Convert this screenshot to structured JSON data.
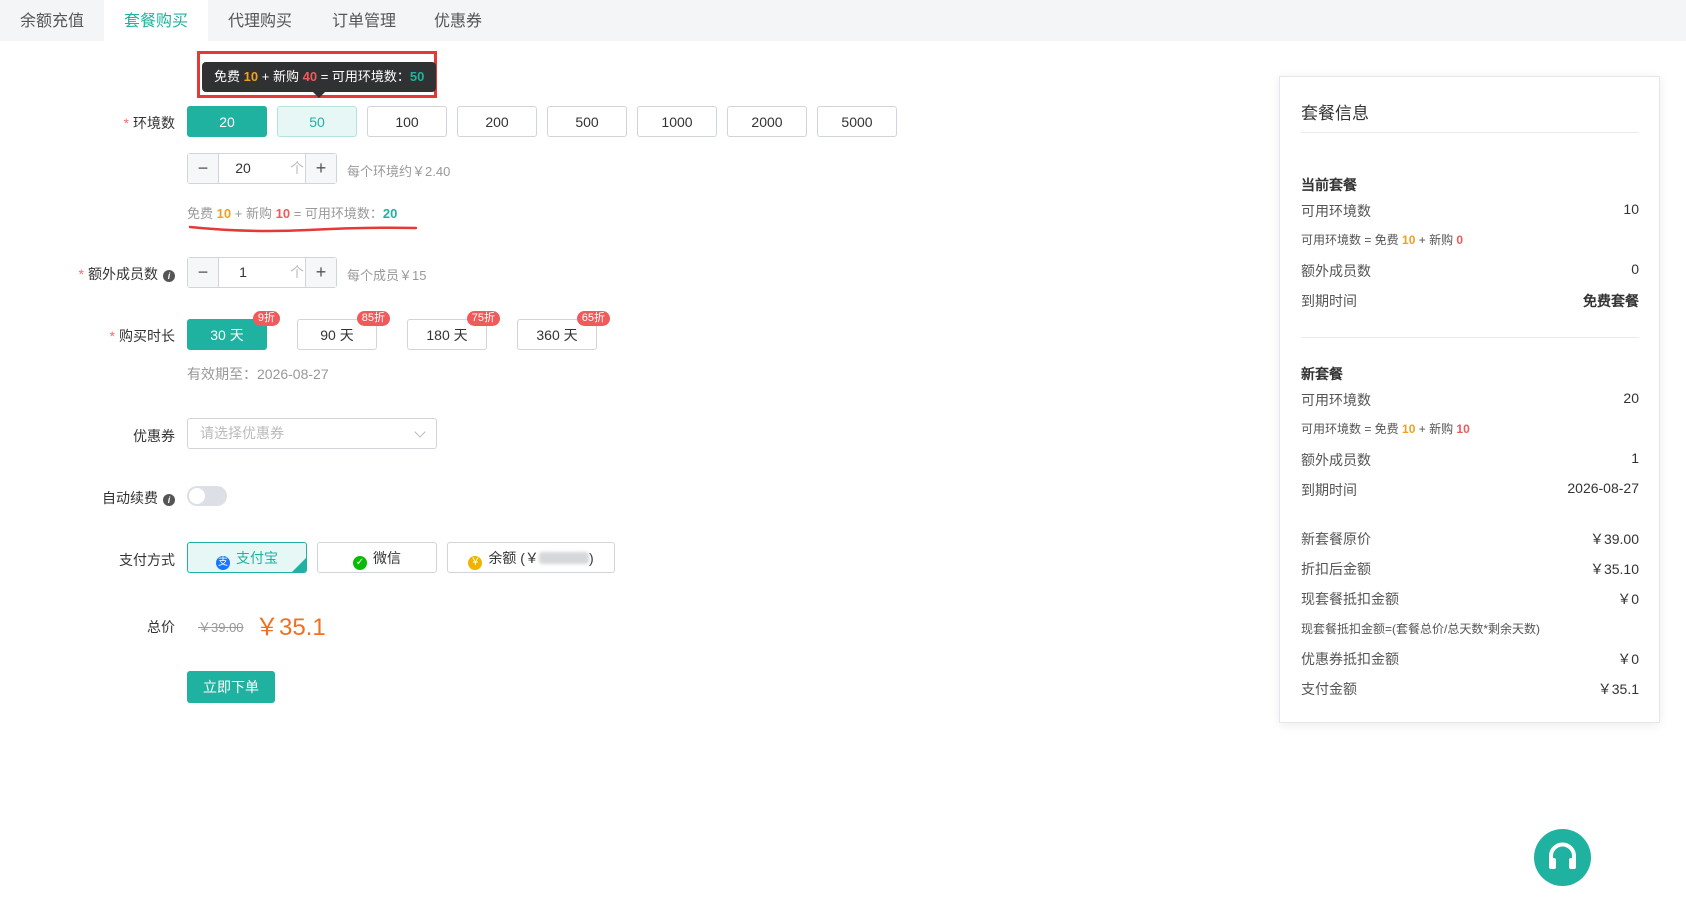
{
  "tabs": [
    "余额充值",
    "套餐购买",
    "代理购买",
    "订单管理",
    "优惠券"
  ],
  "tooltip": {
    "free_label": "免费",
    "free": "10",
    "plus": "+",
    "new_label": "新购",
    "new": "40",
    "eq": "=",
    "avail_label": "可用环境数：",
    "avail": "50"
  },
  "env": {
    "label": "环境数",
    "options": [
      "20",
      "50",
      "100",
      "200",
      "500",
      "1000",
      "2000",
      "5000"
    ],
    "stepper_value": "20",
    "stepper_unit": "个",
    "price_hint": "每个环境约￥2.40",
    "summary": {
      "free_label": "免费",
      "free": "10",
      "plus": "+",
      "new_label": "新购",
      "new": "10",
      "eq": "=",
      "avail_label": "可用环境数：",
      "avail": "20"
    }
  },
  "members": {
    "label": "额外成员数",
    "stepper_value": "1",
    "stepper_unit": "个",
    "price_hint": "每个成员￥15"
  },
  "duration": {
    "label": "购买时长",
    "options": [
      {
        "label": "30 天",
        "badge": "9折"
      },
      {
        "label": "90 天",
        "badge": "85折"
      },
      {
        "label": "180 天",
        "badge": "75折"
      },
      {
        "label": "360 天",
        "badge": "65折"
      }
    ],
    "expiry": "有效期至：2026-08-27"
  },
  "coupon": {
    "label": "优惠券",
    "placeholder": "请选择优惠券"
  },
  "auto_renew": {
    "label": "自动续费"
  },
  "payment": {
    "label": "支付方式",
    "methods": [
      "支付宝",
      "微信",
      "余额 (￥"
    ],
    "balance_suffix": ")"
  },
  "total": {
    "label": "总价",
    "original": "￥39.00",
    "price": "￥35.1"
  },
  "submit_label": "立即下单",
  "panel": {
    "title": "套餐信息",
    "current": {
      "title": "当前套餐",
      "avail_label": "可用环境数",
      "avail": "10",
      "formula_prefix": "可用环境数 = 免费",
      "formula_free": "10",
      "formula_mid": "+ 新购",
      "formula_new": "0",
      "members_label": "额外成员数",
      "members": "0",
      "expiry_label": "到期时间",
      "expiry": "免费套餐"
    },
    "new": {
      "title": "新套餐",
      "avail_label": "可用环境数",
      "avail": "20",
      "formula_prefix": "可用环境数 = 免费",
      "formula_free": "10",
      "formula_mid": "+ 新购",
      "formula_new": "10",
      "members_label": "额外成员数",
      "members": "1",
      "expiry_label": "到期时间",
      "expiry": "2026-08-27"
    },
    "costs": [
      {
        "label": "新套餐原价",
        "value": "￥39.00"
      },
      {
        "label": "折扣后金额",
        "value": "￥35.10"
      },
      {
        "label": "现套餐抵扣金额",
        "value": "￥0"
      }
    ],
    "deduct_note": "现套餐抵扣金额=(套餐总价/总天数*剩余天数)",
    "costs2": [
      {
        "label": "优惠券抵扣金额",
        "value": "￥0"
      },
      {
        "label": "支付金额",
        "value": "￥35.1"
      }
    ]
  },
  "colors": {
    "accent": "#20b2a0",
    "price": "#f07020",
    "badge": "#f05a5a",
    "free": "#f0a020"
  }
}
